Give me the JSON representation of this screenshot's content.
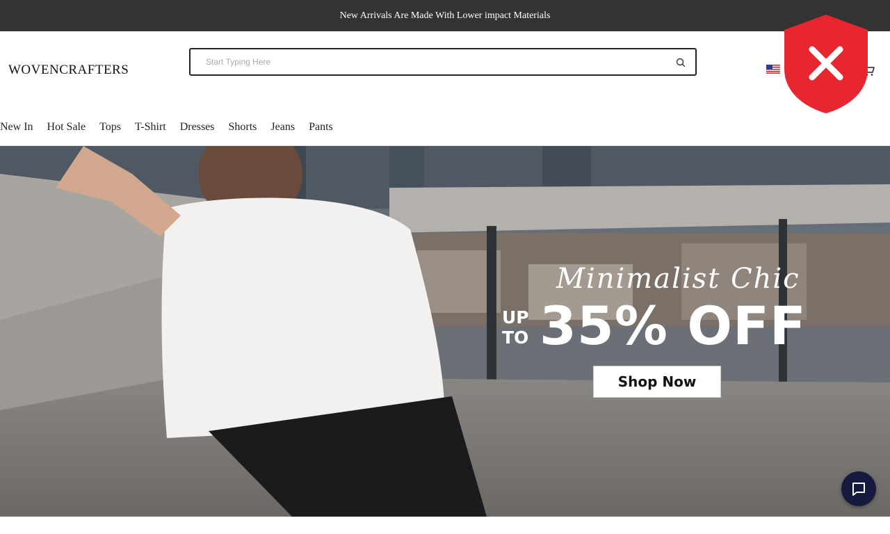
{
  "announcement": {
    "text": "New Arrivals Are Made With Lower impact Materials"
  },
  "header": {
    "logo": "WOVENCRAFTERS",
    "search": {
      "placeholder": "Start Typing Here",
      "value": ""
    },
    "flag": "us-flag-icon",
    "cart": "cart-icon"
  },
  "nav": {
    "items": [
      {
        "label": "New In"
      },
      {
        "label": "Hot Sale"
      },
      {
        "label": "Tops"
      },
      {
        "label": "T-Shirt"
      },
      {
        "label": "Dresses"
      },
      {
        "label": "Shorts"
      },
      {
        "label": "Jeans"
      },
      {
        "label": "Pants"
      }
    ]
  },
  "hero": {
    "script_title": "Minimalist Chic",
    "upto_line1": "UP",
    "upto_line2": "TO",
    "discount": "35% OFF",
    "cta": "Shop Now"
  },
  "overlay": {
    "icon": "blocked-shield-icon",
    "color": "#e8262f"
  },
  "chat": {
    "icon": "chat-icon",
    "color": "#161a3f"
  },
  "colors": {
    "announcement_bg": "#333333",
    "accent": "#161a3f"
  }
}
